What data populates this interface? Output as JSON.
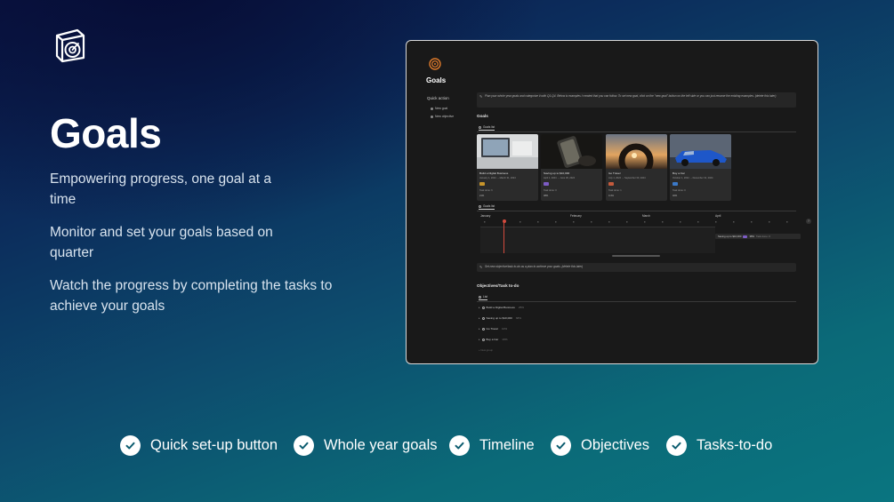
{
  "hero": {
    "title": "Goals",
    "features": [
      "Empowering progress, one goal at a time",
      "Monitor and set your goals based on quarter",
      "Watch the progress by completing the tasks to achieve your goals"
    ]
  },
  "app": {
    "title": "Goals",
    "quick_action": {
      "heading": "Quick action",
      "items": [
        "New goal",
        "New objective"
      ]
    },
    "callout_top": "Plan your whole year goals and categorize it with Q1-Q4. Below is examples I created that you can follow. To set new goal, click on the \"new goal\" button on the left side or you can just rename the existing examples. (delete this later)",
    "goals_section": "Goals",
    "goals_view": "Goals list",
    "cards": [
      {
        "name": "Build a Digital Business",
        "date": "January 1, 2024 → March 31, 2024",
        "tasks": "Task done: 6",
        "pct": "21%",
        "tag_color": "#c8952b"
      },
      {
        "name": "Saving up to $10,000",
        "date": "April 1, 2024 → June 30, 2024",
        "tasks": "Task done: 0",
        "pct": "38%",
        "tag_color": "#7c5cc4"
      },
      {
        "name": "Go Travel",
        "date": "July 1, 2024 → September 30, 2024",
        "tasks": "Task done: 1",
        "pct": "0.4%",
        "tag_color": "#c45a3c"
      },
      {
        "name": "Buy a Car",
        "date": "October 1, 2024 → December 31, 2024",
        "tasks": "Task done: 0",
        "pct": "40%",
        "tag_color": "#3b79c8"
      }
    ],
    "timeline_view": "Goals list",
    "months": [
      "January",
      "February",
      "March",
      "April"
    ],
    "timeline_bar": {
      "label": "Saving up to $10,000",
      "pct": "38%",
      "tasks": "Task done: 0"
    },
    "callout_bottom": "Set new objective/task to-do as a plan to achieve your goals. (delete this later)",
    "objectives_section": "Objectives/Task to-do",
    "objectives_view": "List",
    "objectives": [
      {
        "name": "Build a Digital Business",
        "pct": "25%"
      },
      {
        "name": "Saving up to $10,000",
        "pct": "38%"
      },
      {
        "name": "Go Travel",
        "pct": "10%"
      },
      {
        "name": "Buy a Car",
        "pct": "10%"
      }
    ],
    "new_item": "+ New group"
  },
  "chips": [
    "Quick set-up button",
    "Whole year goals",
    "Timeline",
    "Objectives",
    "Tasks-to-do"
  ],
  "colors": {
    "accent_orange": "#e07b2b",
    "today_red": "#d24a3d"
  }
}
